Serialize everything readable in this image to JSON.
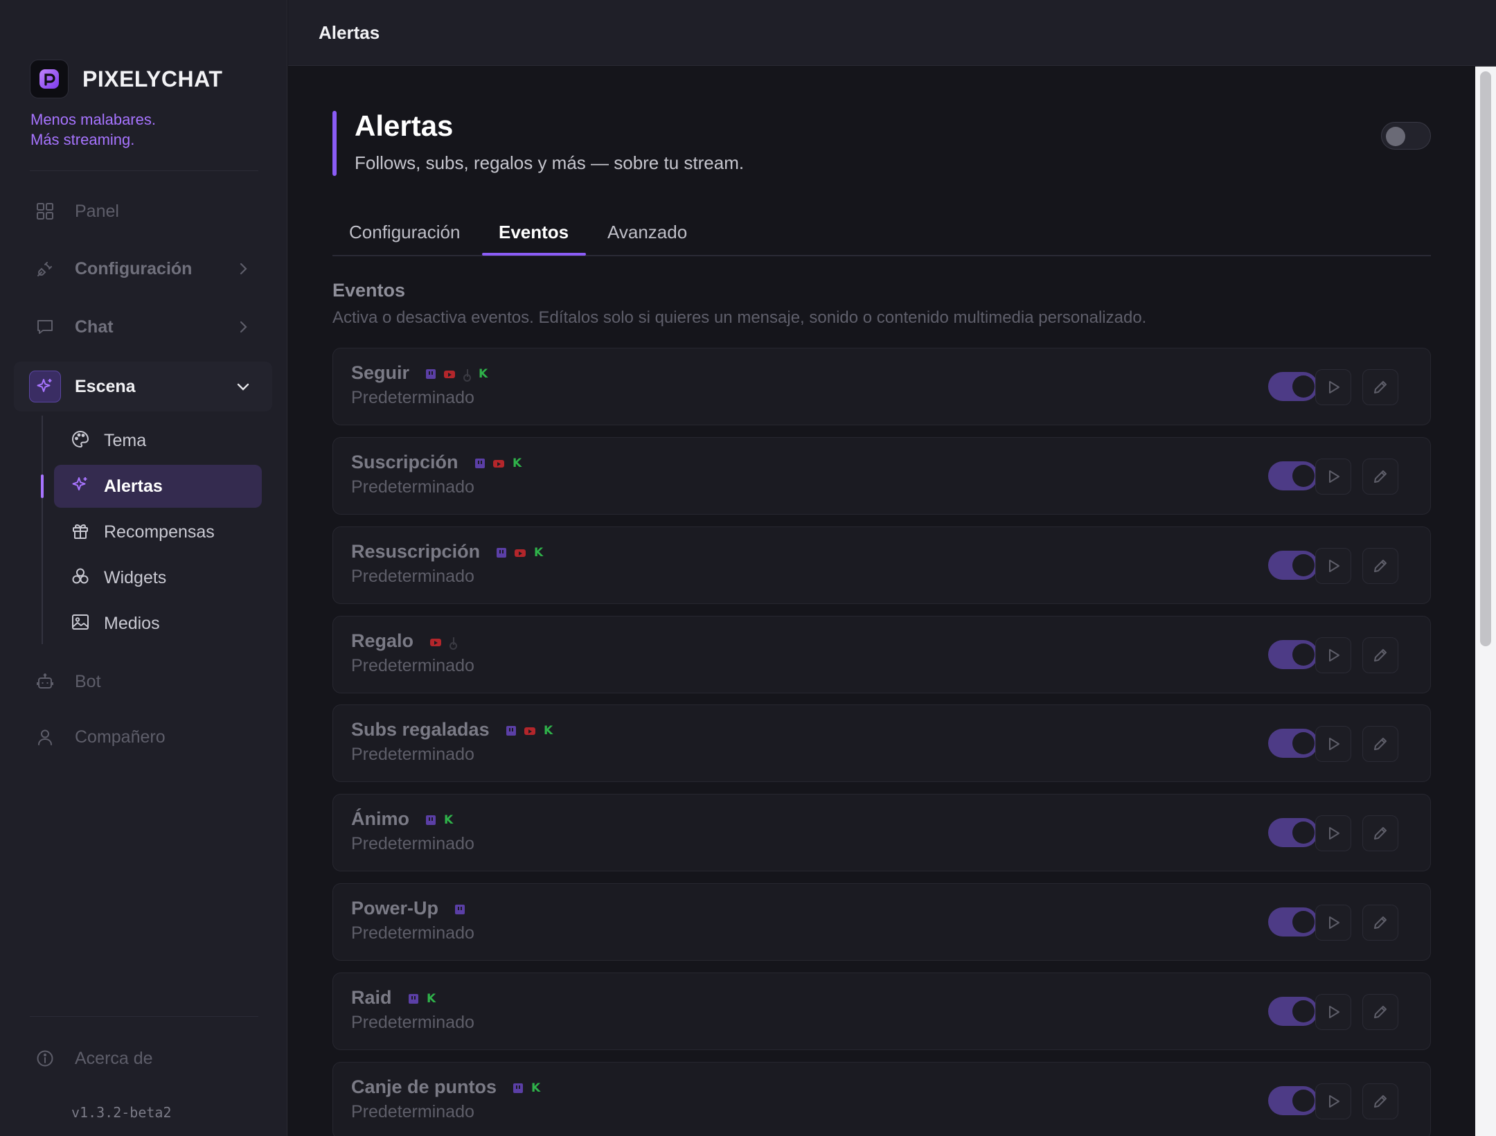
{
  "app": {
    "brand": "PIXELYCHAT",
    "tagline_line1": "Menos malabares.",
    "tagline_line2": "Más streaming.",
    "version": "v1.3.2-beta2",
    "accent_color": "#8b5cf6"
  },
  "sidebar": {
    "items": [
      {
        "label": "Panel",
        "icon": "grid-icon"
      },
      {
        "label": "Configuración",
        "icon": "plug-icon"
      },
      {
        "label": "Chat",
        "icon": "chat-icon"
      },
      {
        "label": "Escena",
        "icon": "sparkle-icon"
      },
      {
        "label": "Bot",
        "icon": "robot-icon"
      },
      {
        "label": "Compañero",
        "icon": "user-icon"
      },
      {
        "label": "Acerca de",
        "icon": "info-icon"
      }
    ],
    "subitems": [
      {
        "label": "Tema",
        "icon": "palette-icon"
      },
      {
        "label": "Alertas",
        "icon": "sparkle-icon"
      },
      {
        "label": "Recompensas",
        "icon": "gift-icon"
      },
      {
        "label": "Widgets",
        "icon": "widgets-icon"
      },
      {
        "label": "Medios",
        "icon": "image-icon"
      }
    ]
  },
  "topbar": {
    "title": "Alertas"
  },
  "page": {
    "title": "Alertas",
    "subtitle": "Follows, subs, regalos y más — sobre tu stream.",
    "enabled": false
  },
  "tabs": [
    {
      "label": "Configuración",
      "active": false
    },
    {
      "label": "Eventos",
      "active": true
    },
    {
      "label": "Avanzado",
      "active": false
    }
  ],
  "section": {
    "title": "Eventos",
    "description": "Activa o desactiva eventos. Edítalos solo si quieres un mensaje, sonido o contenido multimedia personalizado."
  },
  "events": [
    {
      "name": "Seguir",
      "status": "Predeterminado",
      "platforms": [
        "twitch",
        "youtube",
        "tiktok",
        "kick"
      ],
      "enabled": true
    },
    {
      "name": "Suscripción",
      "status": "Predeterminado",
      "platforms": [
        "twitch",
        "youtube",
        "kick"
      ],
      "enabled": true
    },
    {
      "name": "Resuscripción",
      "status": "Predeterminado",
      "platforms": [
        "twitch",
        "youtube",
        "kick"
      ],
      "enabled": true
    },
    {
      "name": "Regalo",
      "status": "Predeterminado",
      "platforms": [
        "youtube",
        "tiktok"
      ],
      "enabled": true
    },
    {
      "name": "Subs regaladas",
      "status": "Predeterminado",
      "platforms": [
        "twitch",
        "youtube",
        "kick"
      ],
      "enabled": true
    },
    {
      "name": "Ánimo",
      "status": "Predeterminado",
      "platforms": [
        "twitch",
        "kick"
      ],
      "enabled": true
    },
    {
      "name": "Power-Up",
      "status": "Predeterminado",
      "platforms": [
        "twitch"
      ],
      "enabled": true
    },
    {
      "name": "Raid",
      "status": "Predeterminado",
      "platforms": [
        "twitch",
        "kick"
      ],
      "enabled": true
    },
    {
      "name": "Canje de puntos",
      "status": "Predeterminado",
      "platforms": [
        "twitch",
        "kick"
      ],
      "enabled": true
    }
  ]
}
